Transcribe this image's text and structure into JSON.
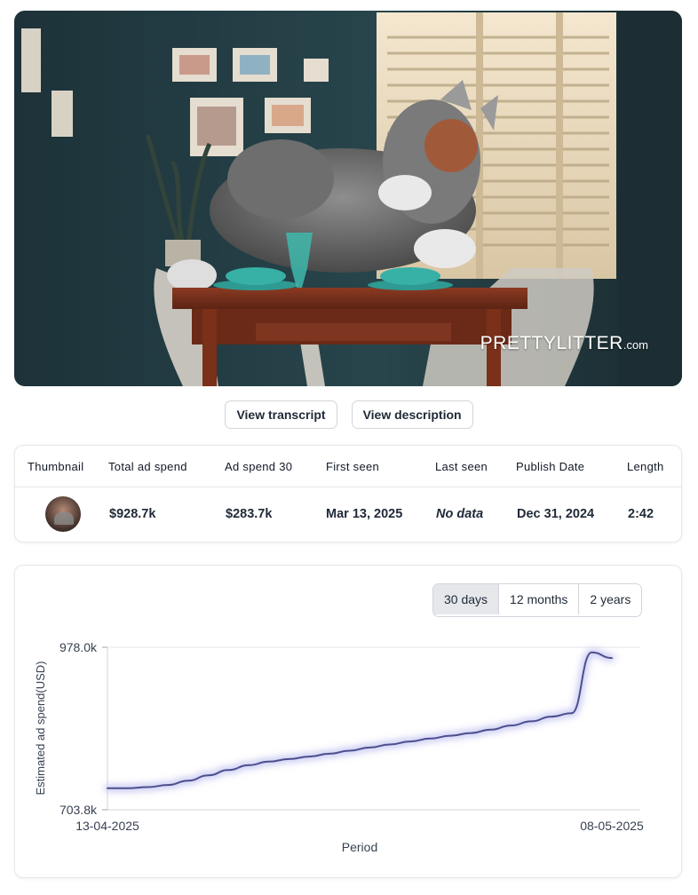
{
  "hero": {
    "brand_main": "PRETTYLITTER",
    "brand_suffix": ".com"
  },
  "actions": {
    "transcript_label": "View transcript",
    "description_label": "View description"
  },
  "stats": {
    "headers": [
      "Thumbnail",
      "Total ad spend",
      "Ad spend 30",
      "First seen",
      "Last seen",
      "Publish Date",
      "Length"
    ],
    "row": {
      "total_ad_spend": "$928.7k",
      "ad_spend_30": "$283.7k",
      "first_seen": "Mar 13, 2025",
      "last_seen": "No data",
      "publish_date": "Dec 31, 2024",
      "length": "2:42"
    }
  },
  "range_selector": {
    "options": [
      "30 days",
      "12 months",
      "2 years"
    ],
    "selected": "30 days"
  },
  "colors": {
    "line": "#4b4f8f",
    "line_glow": "#c7c8f2"
  },
  "chart_data": {
    "type": "line",
    "xlabel": "Period",
    "ylabel": "Estimated ad spend(USD)",
    "x_tick_labels": [
      "13-04-2025",
      "08-05-2025"
    ],
    "y_tick_labels": [
      "978.0k",
      "703.8k"
    ],
    "ylim": [
      703.8,
      978.0
    ],
    "x": [
      "13-04-2025",
      "14-04-2025",
      "15-04-2025",
      "16-04-2025",
      "17-04-2025",
      "18-04-2025",
      "19-04-2025",
      "20-04-2025",
      "21-04-2025",
      "22-04-2025",
      "23-04-2025",
      "24-04-2025",
      "25-04-2025",
      "26-04-2025",
      "27-04-2025",
      "28-04-2025",
      "29-04-2025",
      "30-04-2025",
      "01-05-2025",
      "02-05-2025",
      "03-05-2025",
      "04-05-2025",
      "05-05-2025",
      "06-05-2025",
      "07-05-2025",
      "08-05-2025"
    ],
    "series": [
      {
        "values": [
          740.2,
          740.2,
          742.0,
          745.6,
          752.8,
          761.9,
          771.0,
          779.0,
          785.0,
          789.3,
          793.6,
          798.3,
          803.5,
          808.8,
          814.0,
          819.0,
          824.0,
          828.8,
          833.2,
          839.0,
          846.0,
          853.0,
          861.0,
          866.7,
          969.4,
          959.8
        ]
      }
    ],
    "grid": false,
    "legend": "none"
  }
}
